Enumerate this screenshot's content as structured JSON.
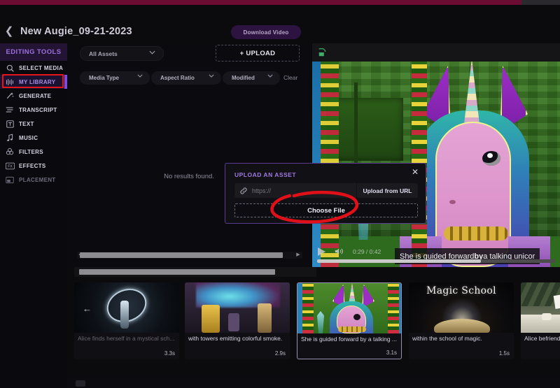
{
  "header": {
    "back_icon": "chevron-left-icon",
    "project_title": "New Augie_09-21-2023",
    "download_label": "Download Video"
  },
  "sidebar": {
    "section_title": "EDITING TOOLS",
    "items": [
      {
        "label": "SELECT MEDIA",
        "icon": "search-icon",
        "state": "normal"
      },
      {
        "label": "MY LIBRARY",
        "icon": "waveform-icon",
        "state": "active"
      },
      {
        "label": "GENERATE",
        "icon": "magic-wand-icon",
        "state": "normal"
      },
      {
        "label": "TRANSCRIPT",
        "icon": "lines-icon",
        "state": "normal"
      },
      {
        "label": "TEXT",
        "icon": "text-box-icon",
        "state": "normal"
      },
      {
        "label": "MUSIC",
        "icon": "music-note-icon",
        "state": "normal"
      },
      {
        "label": "FILTERS",
        "icon": "filters-icon",
        "state": "normal"
      },
      {
        "label": "EFFECTS",
        "icon": "fx-icon",
        "state": "normal"
      },
      {
        "label": "PLACEMENT",
        "icon": "placement-icon",
        "state": "dim"
      }
    ]
  },
  "browser": {
    "asset_filter": "All Assets",
    "upload_label": "+ UPLOAD",
    "chips": [
      {
        "label": "Media Type"
      },
      {
        "label": "Aspect Ratio"
      },
      {
        "label": "Modified"
      }
    ],
    "clear_label": "Clear",
    "empty_message": "No results found."
  },
  "modal": {
    "title": "UPLOAD AN ASSET",
    "close_icon": "close-icon",
    "link_icon": "link-icon",
    "url_value": "",
    "url_placeholder": "https://",
    "upload_url_label": "Upload from URL",
    "choose_file_label": "Choose File"
  },
  "preview": {
    "crop_icon": "crop-resize-icon",
    "caption_prefix": "She is guided forward ",
    "caption_bold": "by",
    "caption_suffix": " a talking unicor",
    "play_icon": "play-icon",
    "volume_icon": "volume-icon",
    "timecode": "0:29 / 0:42"
  },
  "storyboard": {
    "cards": [
      {
        "caption": "Alice finds herself in a mystical sch...",
        "duration": "3.3s",
        "dim": true,
        "selected": false,
        "art": "wizard"
      },
      {
        "caption": "with towers emitting colorful smoke.",
        "duration": "2.9s",
        "dim": false,
        "selected": false,
        "art": "candle"
      },
      {
        "caption": "She is guided forward by a talking ...",
        "duration": "3.1s",
        "dim": false,
        "selected": true,
        "art": "unicorn"
      },
      {
        "caption": "within the school of magic.",
        "duration": "1.5s",
        "dim": false,
        "selected": false,
        "art": "school",
        "art_title": "Magic School"
      },
      {
        "caption": "Alice befriend",
        "duration": "",
        "dim": false,
        "selected": false,
        "art": "tea"
      }
    ]
  },
  "annotations": {
    "library_highlight_color": "#e8141b",
    "choose_file_circle_color": "#e01018"
  },
  "colors": {
    "accent_purple": "#7b4ce0",
    "top_strip": "#6d0c33",
    "background": "#0a0a0d"
  }
}
